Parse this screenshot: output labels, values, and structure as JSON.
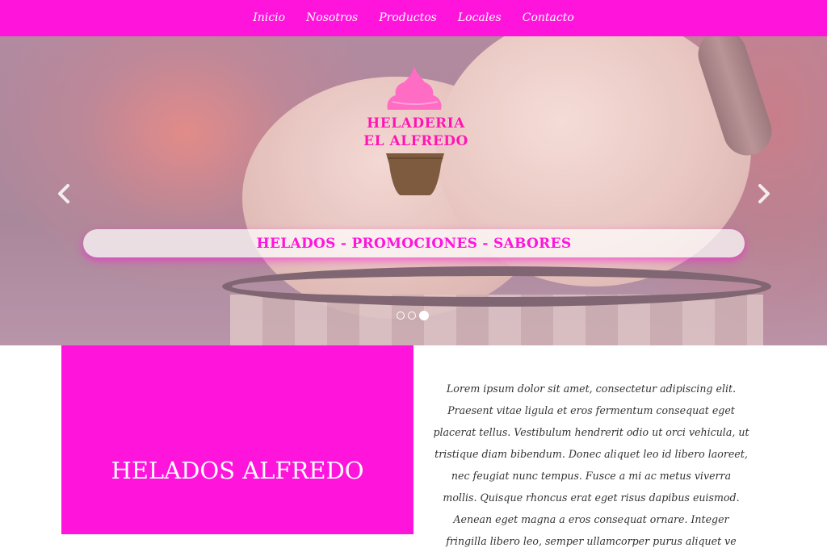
{
  "nav": {
    "items": [
      {
        "label": "Inicio"
      },
      {
        "label": "Nosotros"
      },
      {
        "label": "Productos"
      },
      {
        "label": "Locales"
      },
      {
        "label": "Contacto"
      }
    ]
  },
  "carousel": {
    "logo": {
      "line1": "HELADERIA",
      "line2": "EL ALFREDO"
    },
    "caption": "HELADOS - PROMOCIONES - SABORES",
    "prev_icon": "chevron-left-icon",
    "next_icon": "chevron-right-icon",
    "indicators": {
      "count": 3,
      "active_index": 2
    }
  },
  "feature": {
    "title": "HELADOS ALFREDO",
    "body": "Lorem ipsum dolor sit amet, consectetur adipiscing elit. Praesent vitae ligula et eros fermentum consequat eget placerat tellus. Vestibulum hendrerit odio ut orci vehicula, ut tristique diam bibendum. Donec aliquet leo id libero laoreet, nec feugiat nunc tempus. Fusce a mi ac metus viverra mollis. Quisque rhoncus erat eget risus dapibus euismod. Aenean eget magna a eros consequat ornare. Integer fringilla libero leo, semper ullamcorper purus aliquet ve"
  },
  "colors": {
    "brand_pink": "#ff14dc",
    "logo_pink": "#ff14b0",
    "cone_brown": "#7e5a3e"
  }
}
